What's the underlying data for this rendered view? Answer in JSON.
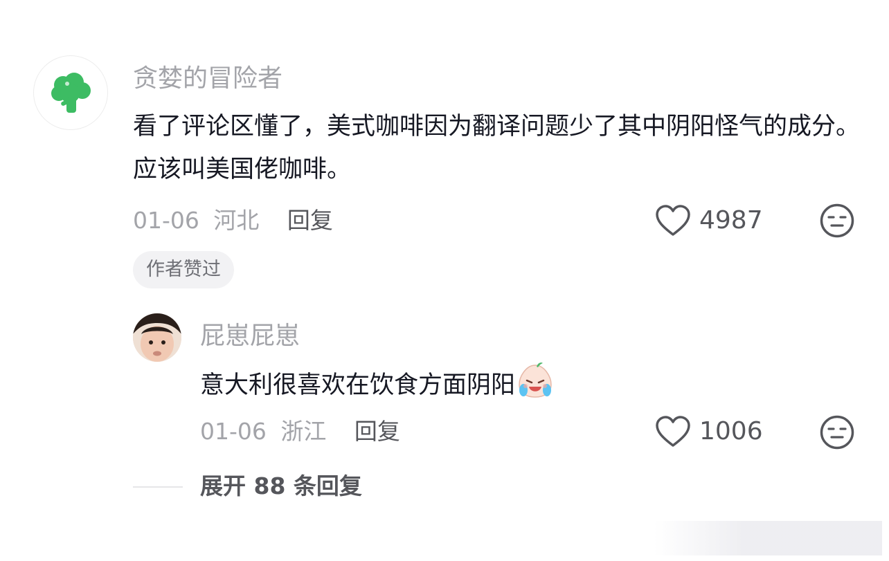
{
  "comment": {
    "username": "贪婪的冒险者",
    "text": "看了评论区懂了，美式咖啡因为翻译问题少了其中阴阳怪气的成分。应该叫美国佬咖啡。",
    "date": "01-06",
    "location": "河北",
    "reply_label": "回复",
    "likes": "4987",
    "badge": "作者赞过",
    "avatar_icon": "broccoli-icon"
  },
  "reply": {
    "username": "屁崽屁崽",
    "text": "意大利很喜欢在饮食方面阴阳",
    "emoji_icon": "crying-laughing-emoji-icon",
    "date": "01-06",
    "location": "浙江",
    "reply_label": "回复",
    "likes": "1006"
  },
  "expand": {
    "label": "展开 88 条回复"
  },
  "colors": {
    "broccoli": "#3dbc63",
    "muted_text": "#a3a4a9",
    "action_text": "#55565b"
  }
}
